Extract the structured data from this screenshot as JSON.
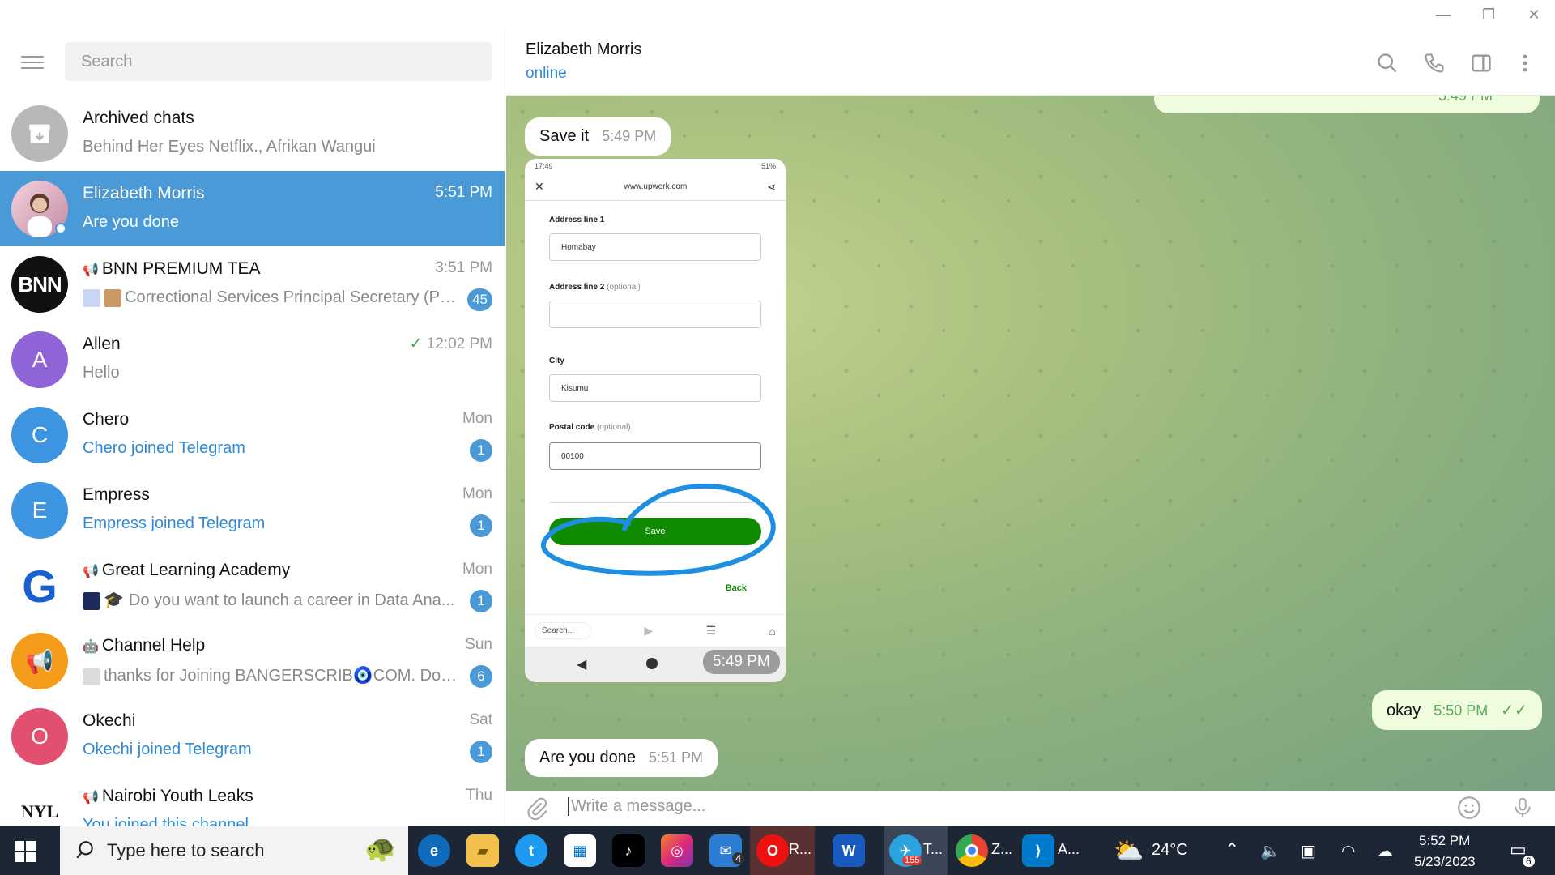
{
  "window": {
    "minimize": "—",
    "restore": "❐",
    "close": "✕"
  },
  "search": {
    "placeholder": "Search"
  },
  "chats": [
    {
      "name": "Archived chats",
      "preview": "Behind Her Eyes Netflix., Afrikan Wangui",
      "time": "",
      "badge": "",
      "avatar_text": "",
      "avatar_color": "#b0b0b0"
    },
    {
      "name": "Elizabeth Morris",
      "preview": "Are you done",
      "time": "5:51 PM",
      "badge": "",
      "avatar_text": "",
      "avatar_color": "#d7a6b8"
    },
    {
      "name": "BNN PREMIUM TEA",
      "preview": "Correctional Services Principal Secretary (PS...",
      "time": "3:51 PM",
      "badge": "45",
      "avatar_text": "BNN",
      "avatar_color": "#111111"
    },
    {
      "name": "Allen",
      "preview": "Hello",
      "time": "12:02 PM",
      "badge": "",
      "avatar_text": "A",
      "avatar_color": "#8e64d6"
    },
    {
      "name": "Chero",
      "preview": "Chero joined Telegram",
      "time": "Mon",
      "badge": "1",
      "avatar_text": "C",
      "avatar_color": "#3d94e0"
    },
    {
      "name": "Empress",
      "preview": "Empress joined Telegram",
      "time": "Mon",
      "badge": "1",
      "avatar_text": "E",
      "avatar_color": "#3d94e0"
    },
    {
      "name": "Great Learning Academy",
      "preview": "Do you want to launch a career in Data Ana...",
      "time": "Mon",
      "badge": "1",
      "avatar_text": "G",
      "avatar_color": "#ffffff"
    },
    {
      "name": "Channel Help",
      "preview": "thanks for Joining BANGERSCRIB🧿COM. Don't ...",
      "time": "Sun",
      "badge": "6",
      "avatar_text": "📢",
      "avatar_color": "#f59b1a"
    },
    {
      "name": "Okechi",
      "preview": "Okechi joined Telegram",
      "time": "Sat",
      "badge": "1",
      "avatar_text": "O",
      "avatar_color": "#e3506f"
    },
    {
      "name": "Nairobi Youth Leaks",
      "preview": "You joined this channel",
      "time": "Thu",
      "badge": "",
      "avatar_text": "NYL",
      "avatar_color": "#ffffff"
    }
  ],
  "header": {
    "name": "Elizabeth Morris",
    "status": "online"
  },
  "messages": {
    "m1": {
      "text": "Save it",
      "time": "5:49 PM"
    },
    "image_time": "5:49 PM",
    "m2": {
      "text": "okay",
      "time": "5:50 PM"
    },
    "m3": {
      "text": "Are you done",
      "time": "5:51 PM"
    },
    "top_partial_time": "5:49 PM"
  },
  "screenshot": {
    "status_time": "17:49",
    "battery": "51%",
    "url": "www.upwork.com",
    "address1_label": "Address line 1",
    "address1_value": "Homabay",
    "address2_label": "Address line 2",
    "address2_optional": "(optional)",
    "city_label": "City",
    "city_value": "Kisumu",
    "postal_label": "Postal code",
    "postal_optional": "(optional)",
    "postal_value": "00100",
    "save_label": "Save",
    "back_label": "Back",
    "bottom_search": "Search..."
  },
  "composer": {
    "placeholder": "Write a message..."
  },
  "taskbar": {
    "search_placeholder": "Type here to search",
    "telegram_label": "T...",
    "telegram_badge": "155",
    "chrome_label": "Z...",
    "vscode_label": "A...",
    "opera_label": "R...",
    "mail_badge": "4",
    "weather": "24°C",
    "time": "5:52 PM",
    "date": "5/23/2023",
    "notif_count": "6"
  }
}
